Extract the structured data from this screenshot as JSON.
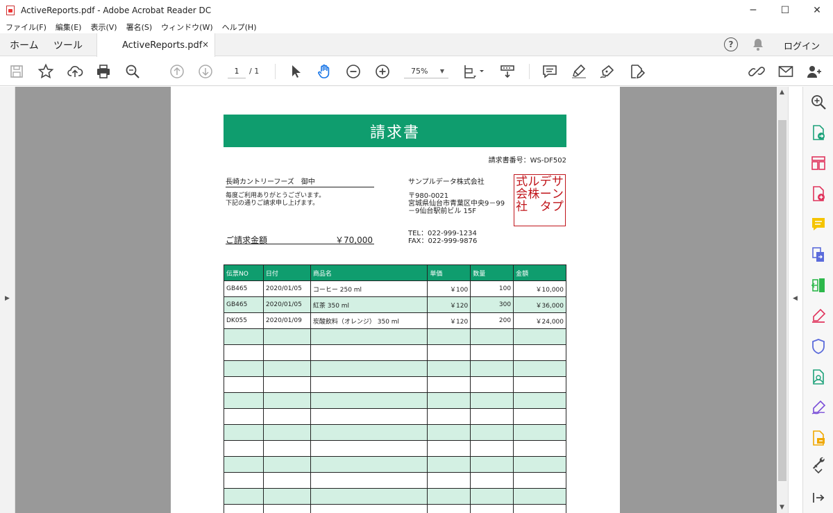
{
  "window": {
    "title": "ActiveReports.pdf - Adobe Acrobat Reader DC",
    "minimize_glyph": "─",
    "maximize_glyph": "☐",
    "close_glyph": "✕"
  },
  "menu": [
    "ファイル(F)",
    "編集(E)",
    "表示(V)",
    "署名(S)",
    "ウィンドウ(W)",
    "ヘルプ(H)"
  ],
  "tabs": {
    "home": "ホーム",
    "tools": "ツール",
    "document": "ActiveReports.pdf",
    "close_glyph": "×"
  },
  "header_right": {
    "help": "?",
    "login": "ログイン"
  },
  "toolbar": {
    "page_current": "1",
    "page_total": "/ 1",
    "zoom": "75%",
    "zoom_caret": "▼",
    "icons": [
      "save-icon",
      "star-icon",
      "upload-icon",
      "print-icon",
      "search-icon",
      "page-up-icon",
      "page-down-icon",
      "select-cursor-icon",
      "hand-tool-icon",
      "zoom-out-icon",
      "zoom-in-icon",
      "fit-page-icon",
      "scroll-mode-icon",
      "comment-icon",
      "highlight-icon",
      "sign-icon",
      "fill-sign-icon",
      "share-link-icon",
      "email-icon",
      "add-user-icon"
    ]
  },
  "gutter": {
    "left_arrow": "▶",
    "right_arrow": "◀",
    "scroll_up": "▲",
    "scroll_down": "▼"
  },
  "right_panel_icons": [
    "search-zoom-icon",
    "export-pdf-icon",
    "organize-pages-icon",
    "create-pdf-icon",
    "comment-tool-icon",
    "combine-files-icon",
    "compress-icon",
    "fill-sign-tool-icon",
    "protect-icon",
    "send-review-icon",
    "edit-sign-icon",
    "send-track-icon",
    "more-tools-icon",
    "collapse-panel-icon"
  ],
  "invoice": {
    "title": "請求書",
    "number_label": "請求書番号：WS-DF502",
    "customer": "長崎カントリーフーズ　御中",
    "message_line1": "毎度ご利用ありがとうございます。",
    "message_line2": "下記の通りご請求申し上げます。",
    "amount_label": "ご請求金額",
    "amount_value": "￥70,000",
    "company": "サンプルデータ株式会社",
    "postal": "〒980-0021",
    "address_line1": "宮城県仙台市青葉区中央9－99",
    "address_line2": "－9仙台駅前ビル 15F",
    "tel": "TEL：022-999-1234",
    "fax": "FAX：022-999-9876",
    "seal_columns": [
      "サンプ",
      "デー タ",
      "ル株",
      "式会社"
    ],
    "seal_text": "サンプルデータ株式会社",
    "columns": [
      "伝票NO",
      "日付",
      "商品名",
      "単価",
      "数量",
      "金額"
    ],
    "rows": [
      [
        "GB465",
        "2020/01/05",
        "コーヒー 250 ml",
        "￥100",
        "100",
        "￥10,000"
      ],
      [
        "GB465",
        "2020/01/05",
        "紅茶 350 ml",
        "￥120",
        "300",
        "￥36,000"
      ],
      [
        "DK055",
        "2020/01/09",
        "炭酸飲料（オレンジ） 350 ml",
        "￥120",
        "200",
        "￥24,000"
      ]
    ],
    "empty_rows": 12
  },
  "colors": {
    "accent_green": "#0f9d6e",
    "row_alt": "#d3f0e3",
    "seal_red": "#c0141a",
    "viewer_bg": "#999999"
  }
}
